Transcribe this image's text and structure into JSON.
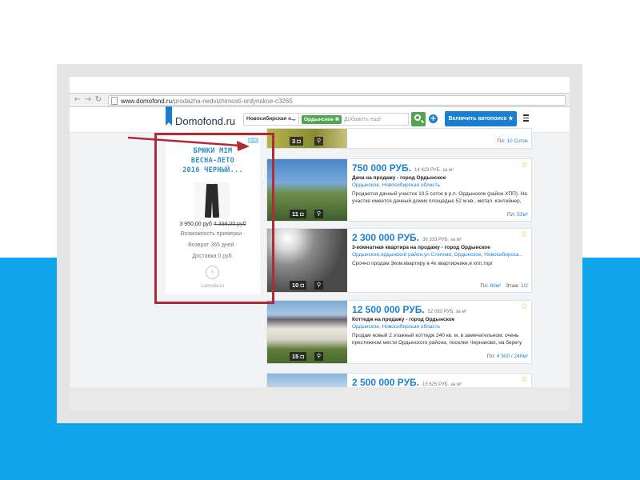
{
  "browser": {
    "url_host": "www.domofond.ru",
    "url_path": "/prodazha-nedvizhimosti-ordynskoe-c3265"
  },
  "header": {
    "logo": "Domofond.ru",
    "region_select": "Новосибирская о...",
    "location_tag": "Ордынское",
    "tag_remove": "✖",
    "search_placeholder": "Добавить еще",
    "autosearch_button": "Включить автопоиск ★"
  },
  "ad": {
    "choice": "⊳✕",
    "title_lines": [
      "БРЮКИ MIM",
      "ВЕСНА-ЛЕТО",
      "2016 ЧЕРНЫЙ..."
    ],
    "price_new": "3 950,00 руб",
    "price_old": "4 399,00 руб",
    "line1": "Возможность примерки ·",
    "line2": "Возврат 365 дней ·",
    "line3": "Доставка 0 руб.",
    "go": "›",
    "source": "Lamoda.ru"
  },
  "listings": [
    {
      "photos": "3",
      "area_label": "Пл:",
      "area_value": "10 Соток"
    },
    {
      "price": "750 000 РУБ.",
      "price_per": "14 423 РУБ. за м²",
      "title": "Дача на продажу - город Ордынское",
      "location": "Ордынское, Новосибирская область",
      "description": "Продается дачный участок 10,5 соток в р.п. Ордынское (район ХПП). На участке имеется дачный домик площадью 52 м.кв., метал. контейнер,",
      "photos": "11",
      "area_label": "Пл:",
      "area_value": "52м²"
    },
    {
      "price": "2 300 000 РУБ.",
      "price_per": "38 333 РУБ. за м²",
      "title": "3-комнатная квартира на продажу - город Ордынское",
      "location": "Ордынское,ордынский район,ул Степная, Ордынское, Новосибирска...",
      "description": "Срочно продам 3ком.квартиру в 4х квартирнике,в хпп,торг",
      "photos": "10",
      "area_label": "Пл:",
      "area_value": "60м²",
      "floor_label": "Этаж:",
      "floor_value": "1/2"
    },
    {
      "price": "12 500 000 РУБ.",
      "price_per": "52 083 РУБ. за м²",
      "title": "Коттедж на продажу - город Ордынское",
      "location": "Ордынское, Новосибирская область",
      "description": "Продам новый 2 этажный коттедж 240 кв. м. в замечательном, очень престижном месте Ордынского района, поселке Чернаково, на берегу",
      "photos": "15",
      "area_label": "Пл:",
      "area_value": "4 500 / 240м²"
    },
    {
      "price": "2 500 000 РУБ.",
      "price_per": "15 625 РУБ. за м²"
    }
  ],
  "icons": {
    "back": "back-arrow-icon",
    "forward": "forward-arrow-icon",
    "reload": "reload-icon",
    "camera": "camera-icon",
    "map_pin": "map-pin-icon",
    "star": "favorite-star-icon",
    "menu": "hamburger-menu-icon"
  },
  "colors": {
    "brand_blue": "#1b7fd1",
    "search_green": "#52a450",
    "annotation_red": "#b12a37",
    "background_band": "#10a5e8"
  }
}
